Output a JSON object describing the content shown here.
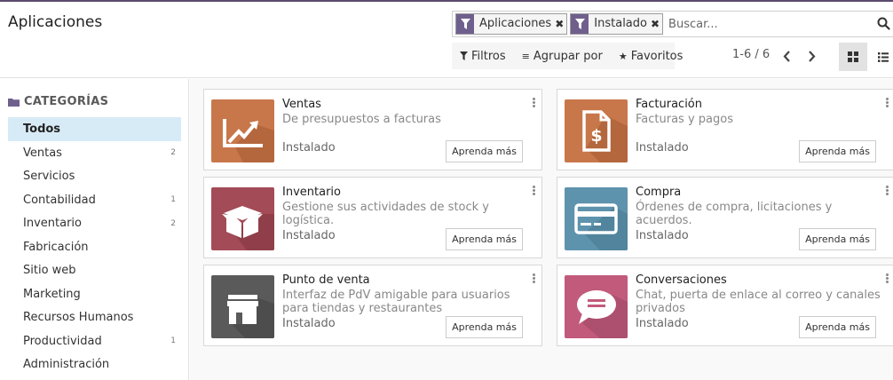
{
  "page_title": "Aplicaciones",
  "search": {
    "facets": [
      {
        "label": "Aplicaciones",
        "icon": "filter-icon"
      },
      {
        "label": "Instalado",
        "icon": "filter-icon"
      }
    ],
    "placeholder": "Buscar..."
  },
  "filters": {
    "filtros": "Filtros",
    "agrupar": "Agrupar por",
    "favoritos": "Favoritos"
  },
  "pager": "1-6 / 6",
  "views": {
    "active": "kanban"
  },
  "sidebar": {
    "title": "CATEGORÍAS",
    "items": [
      {
        "label": "Todos",
        "count": ""
      },
      {
        "label": "Ventas",
        "count": "2"
      },
      {
        "label": "Servicios",
        "count": ""
      },
      {
        "label": "Contabilidad",
        "count": "1"
      },
      {
        "label": "Inventario",
        "count": "2"
      },
      {
        "label": "Fabricación",
        "count": ""
      },
      {
        "label": "Sitio web",
        "count": ""
      },
      {
        "label": "Marketing",
        "count": ""
      },
      {
        "label": "Recursos Humanos",
        "count": ""
      },
      {
        "label": "Productividad",
        "count": "1"
      },
      {
        "label": "Administración",
        "count": ""
      }
    ]
  },
  "apps": [
    {
      "name": "Ventas",
      "desc": "De presupuestos a facturas",
      "status": "Instalado",
      "button": "Aprenda más",
      "color": "#c8774a",
      "icon": "sales-chart-icon"
    },
    {
      "name": "Facturación",
      "desc": "Facturas y pagos",
      "status": "Instalado",
      "button": "Aprenda más",
      "color": "#c8774a",
      "icon": "invoice-dollar-icon"
    },
    {
      "name": "Inventario",
      "desc": "Gestione sus actividades de stock y logística.",
      "status": "Instalado",
      "button": "Aprenda más",
      "color": "#a34b57",
      "icon": "box-icon"
    },
    {
      "name": "Compra",
      "desc": "Órdenes de compra, licitaciones y acuerdos.",
      "status": "Instalado",
      "button": "Aprenda más",
      "color": "#5e93ad",
      "icon": "credit-card-icon"
    },
    {
      "name": "Punto de venta",
      "desc": "Interfaz de PdV amigable para usuarios para tiendas y restaurantes",
      "status": "Instalado",
      "button": "Aprenda más",
      "color": "#5a5a5a",
      "icon": "store-icon"
    },
    {
      "name": "Conversaciones",
      "desc": "Chat, puerta de enlace al correo y canales privados",
      "status": "Instalado",
      "button": "Aprenda más",
      "color": "#c25a7c",
      "icon": "chat-bubble-icon"
    }
  ]
}
